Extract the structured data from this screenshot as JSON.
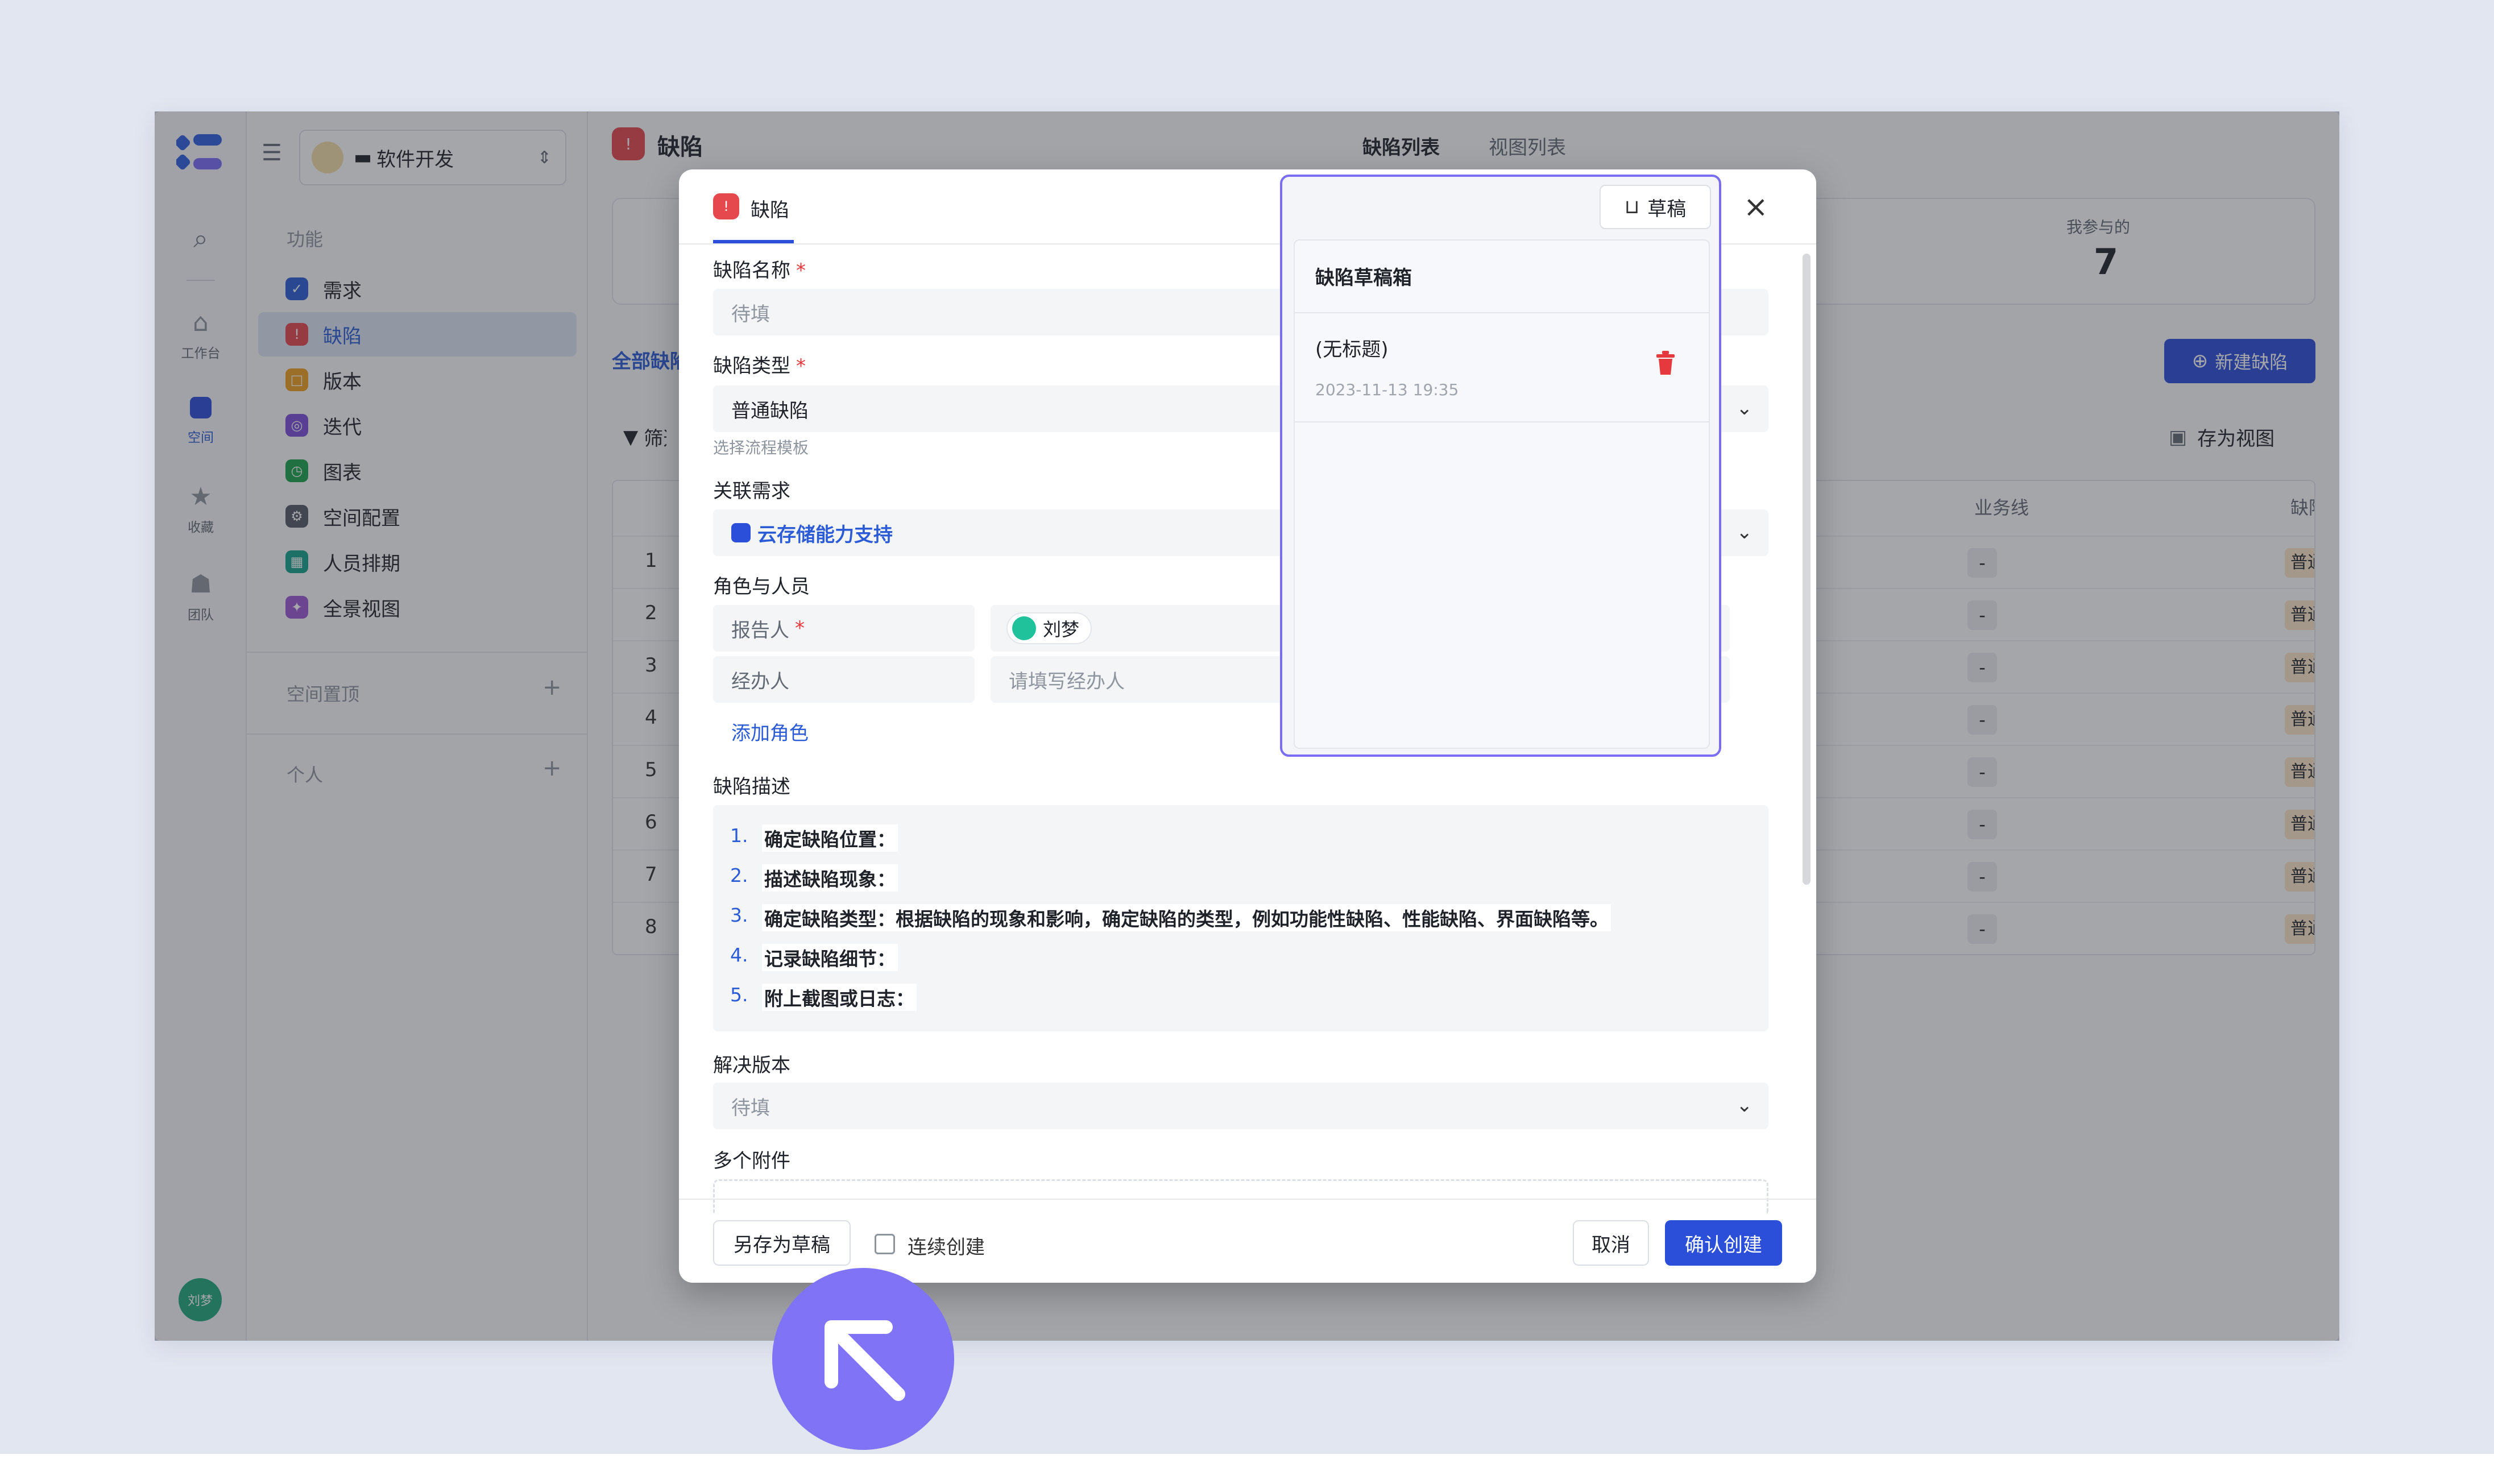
{
  "app": {
    "workspace": "软件开发",
    "rail": [
      "工作台",
      "空间",
      "收藏",
      "团队"
    ],
    "user_avatar": "刘梦"
  },
  "sidebar": {
    "section_label": "功能",
    "items": [
      {
        "label": "需求",
        "color": "#2b5cd6"
      },
      {
        "label": "缺陷",
        "color": "#e5484d"
      },
      {
        "label": "版本",
        "color": "#f0a020"
      },
      {
        "label": "迭代",
        "color": "#7a4fd8"
      },
      {
        "label": "图表",
        "color": "#1aa34a"
      },
      {
        "label": "空间配置",
        "color": "#555b66"
      },
      {
        "label": "人员排期",
        "color": "#14a38b"
      },
      {
        "label": "全景视图",
        "color": "#9b59d0"
      }
    ],
    "pinned_label": "空间置顶",
    "personal_label": "个人"
  },
  "page": {
    "title": "缺陷",
    "tabs": [
      "缺陷列表",
      "视图列表"
    ],
    "stat_label": "我参与的",
    "stat_value": "7",
    "tab_all": "全部缺陷",
    "new_button": "新建缺陷",
    "filter_label": "筛选",
    "save_view": "存为视图",
    "col_business": "业务线",
    "col_defect": "缺陷",
    "row_numbers": [
      "1",
      "2",
      "3",
      "4",
      "5",
      "6",
      "7",
      "8"
    ],
    "cell_dash": "-",
    "cell_tag": "普通"
  },
  "modal": {
    "tab_title": "缺陷",
    "draft_button": "草稿",
    "fields": {
      "name_label": "缺陷名称",
      "name_placeholder": "待填",
      "type_label": "缺陷类型",
      "type_value": "普通缺陷",
      "type_hint": "选择流程模板",
      "link_label": "关联需求",
      "link_value": "云存储能力支持",
      "roles_label": "角色与人员",
      "reporter_label": "报告人",
      "reporter_value": "刘梦",
      "handler_label": "经办人",
      "handler_placeholder": "请填写经办人",
      "add_role": "添加角色",
      "desc_label": "缺陷描述",
      "desc_items": [
        {
          "num": "1.",
          "text": "确定缺陷位置："
        },
        {
          "num": "2.",
          "text": "描述缺陷现象："
        },
        {
          "num": "3.",
          "text": "确定缺陷类型：根据缺陷的现象和影响，确定缺陷的类型，例如功能性缺陷、性能缺陷、界面缺陷等。"
        },
        {
          "num": "4.",
          "text": "记录缺陷细节："
        },
        {
          "num": "5.",
          "text": "附上截图或日志："
        }
      ],
      "version_label": "解决版本",
      "version_placeholder": "待填",
      "attach_label": "多个附件"
    },
    "footer": {
      "save_draft": "另存为草稿",
      "continuous": "连续创建",
      "cancel": "取消",
      "confirm": "确认创建"
    }
  },
  "drafts_popover": {
    "title": "缺陷草稿箱",
    "items": [
      {
        "title": "(无标题)",
        "time": "2023-11-13 19:35"
      }
    ]
  },
  "colors": {
    "primary": "#2b4fd8",
    "highlight": "#7b6cf6",
    "danger": "#e5393e",
    "link": "#2b5cd6"
  }
}
